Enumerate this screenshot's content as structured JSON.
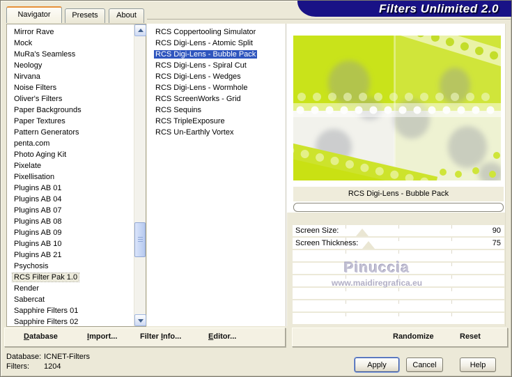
{
  "window": {
    "app_title": "Filters Unlimited 2.0"
  },
  "tabs": [
    {
      "label": "Navigator",
      "active": true
    },
    {
      "label": "Presets",
      "active": false
    },
    {
      "label": "About",
      "active": false
    }
  ],
  "categories": {
    "items": [
      "Mirror Rave",
      "Mock",
      "MuRa's Seamless",
      "Neology",
      "Nirvana",
      "Noise Filters",
      "Oliver's Filters",
      "Paper Backgrounds",
      "Paper Textures",
      "Pattern Generators",
      "penta.com",
      "Photo Aging Kit",
      "Pixelate",
      "Pixellisation",
      "Plugins AB 01",
      "Plugins AB 04",
      "Plugins AB 07",
      "Plugins AB 08",
      "Plugins AB 09",
      "Plugins AB 10",
      "Plugins AB 21",
      "Psychosis",
      "RCS Filter Pak 1.0",
      "Render",
      "Sabercat",
      "Sapphire Filters 01",
      "Sapphire Filters 02"
    ],
    "selected": "RCS Filter Pak 1.0"
  },
  "filters": {
    "items": [
      "RCS Coppertooling Simulator",
      "RCS Digi-Lens - Atomic Split",
      "RCS Digi-Lens - Bubble Pack",
      "RCS Digi-Lens - Spiral Cut",
      "RCS Digi-Lens - Wedges",
      "RCS Digi-Lens - Wormhole",
      "RCS ScreenWorks - Grid",
      "RCS Sequins",
      "RCS TripleExposure",
      "RCS Un-Earthly Vortex"
    ],
    "selected": "RCS Digi-Lens - Bubble Pack"
  },
  "preview": {
    "selected_filter_title": "RCS Digi-Lens - Bubble Pack",
    "watermark_name": "Pinuccia",
    "watermark_url": "www.maidiregrafica.eu"
  },
  "parameters": [
    {
      "label": "Screen Size:",
      "value": "90",
      "pos_pct": 33
    },
    {
      "label": "Screen Thickness:",
      "value": "75",
      "pos_pct": 36
    }
  ],
  "empty_parameter_rows": 6,
  "toolbar": {
    "left": [
      {
        "label": "Database",
        "underline_index": 0
      },
      {
        "label": "Import...",
        "underline_index": 0
      },
      {
        "label": "Filter Info...",
        "underline_index": 7
      },
      {
        "label": "Editor...",
        "underline_index": 0
      }
    ],
    "right": [
      {
        "label": "Randomize",
        "underline_index": -1
      },
      {
        "label": "Reset",
        "underline_index": -1
      }
    ]
  },
  "status": {
    "database_label": "Database:",
    "database_value": "ICNET-Filters",
    "filters_label": "Filters:",
    "filters_value": "1204"
  },
  "action_buttons": {
    "apply": "Apply",
    "cancel": "Cancel",
    "help": "Help"
  },
  "colors": {
    "accent_lime": "#c9e31a",
    "banner_navy": "#191286",
    "selection_blue": "#2e55be",
    "tab_accent_orange": "#e79038",
    "dialog_beige": "#ece9d8"
  }
}
